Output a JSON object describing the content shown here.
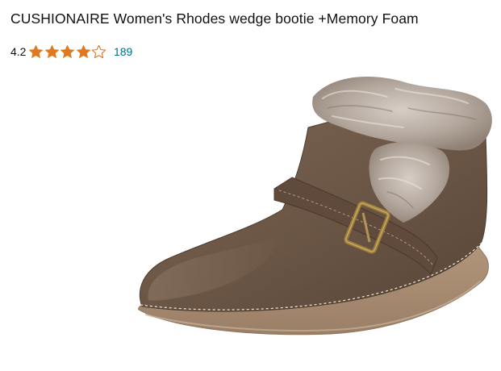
{
  "product": {
    "title": "CUSHIONAIRE Women's Rhodes wedge bootie +Memory Foam",
    "rating": "4.2",
    "rating_value": 4.2,
    "rating_max": 5,
    "review_count": "189",
    "image_subject": "brown-suede-wedge-bootie-with-faux-fur-collar-and-buckle-strap"
  },
  "colors": {
    "star_fill": "#de7921",
    "link": "#007185",
    "text": "#0f1111",
    "suede": "#6b5646",
    "sole": "#a68b71",
    "fur": "#b9aea5"
  }
}
